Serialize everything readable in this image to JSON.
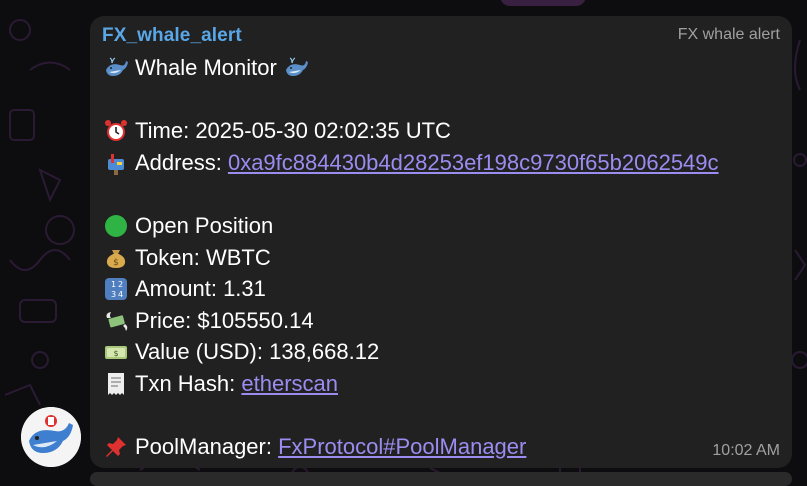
{
  "colors": {
    "background": "#0d0d10",
    "bubble": "#212121",
    "sender": "#5aa7e8",
    "link": "#9b8cf0",
    "meta_text": "#a0a0a0"
  },
  "message": {
    "sender": "FX_whale_alert",
    "label": "FX whale alert",
    "title": "Whale Monitor",
    "title_icons": [
      "whale-icon",
      "whale-icon"
    ],
    "time_label": "Time:",
    "time_value": "2025-05-30 02:02:35 UTC",
    "time_icon": "alarm-clock-icon",
    "address_label": "Address:",
    "address_value": "0xa9fc884430b4d28253ef198c9730f65b2062549c",
    "address_icon": "mailbox-icon",
    "position_label": "Open Position",
    "position_icon": "green-circle-icon",
    "token_label": "Token:",
    "token_value": "WBTC",
    "token_icon": "money-bag-icon",
    "amount_label": "Amount:",
    "amount_value": "1.31",
    "amount_icon": "numbers-icon",
    "price_label": "Price:",
    "price_value": "$105550.14",
    "price_icon": "money-with-wings-icon",
    "value_label": "Value (USD):",
    "value_value": "138,668.12",
    "value_icon": "dollar-banknote-icon",
    "txn_label": "Txn Hash:",
    "txn_link": "etherscan",
    "txn_icon": "receipt-icon",
    "pool_label": "PoolManager:",
    "pool_link": "FxProtocol#PoolManager",
    "pool_icon": "pushpin-icon",
    "timestamp": "10:02 AM"
  },
  "avatar": {
    "icon": "whale-avatar-icon"
  }
}
